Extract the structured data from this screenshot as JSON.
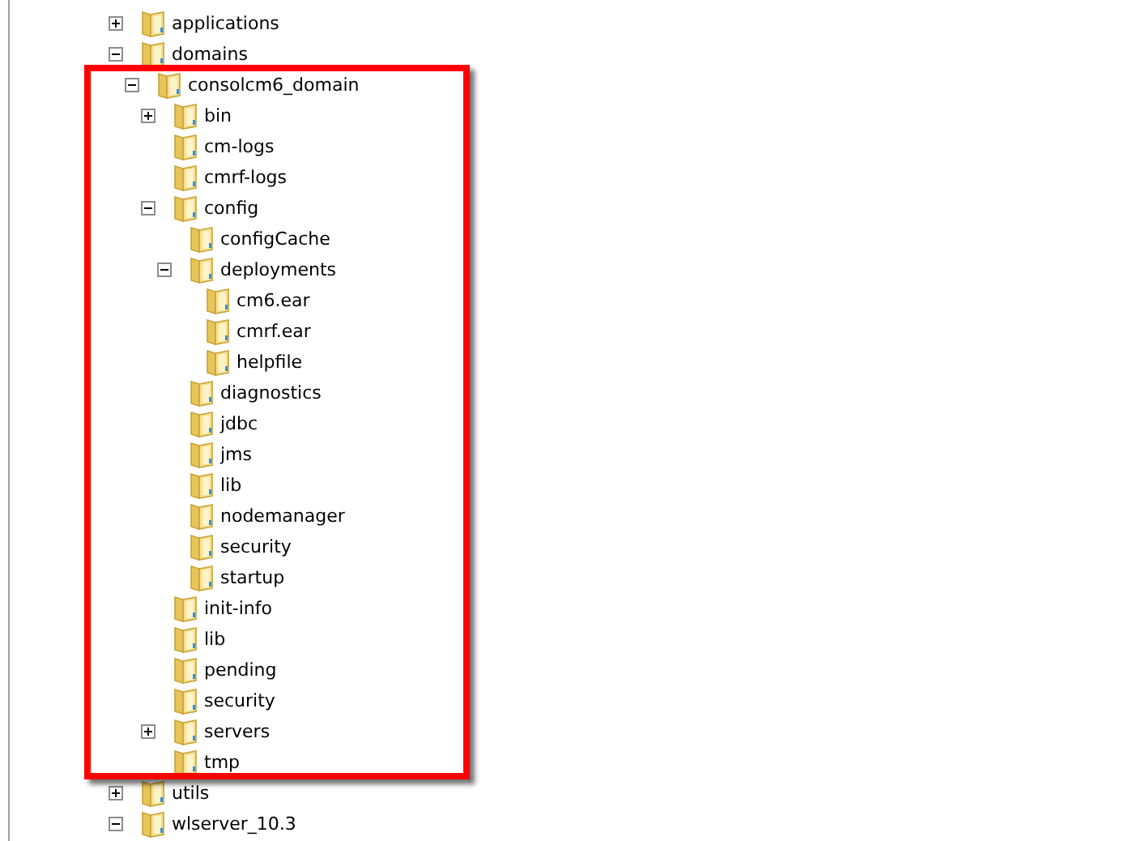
{
  "tree": [
    {
      "label": "applications",
      "kind": "branch",
      "expanded": false
    },
    {
      "label": "domains",
      "kind": "branch",
      "expanded": true,
      "children": [
        {
          "label": "consolcm6_domain",
          "kind": "branch",
          "expanded": true,
          "children": [
            {
              "label": "bin",
              "kind": "branch",
              "expanded": false
            },
            {
              "label": "cm-logs",
              "kind": "leaf"
            },
            {
              "label": "cmrf-logs",
              "kind": "leaf"
            },
            {
              "label": "config",
              "kind": "branch",
              "expanded": true,
              "children": [
                {
                  "label": "configCache",
                  "kind": "leaf"
                },
                {
                  "label": "deployments",
                  "kind": "branch",
                  "expanded": true,
                  "children": [
                    {
                      "label": "cm6.ear",
                      "kind": "leaf"
                    },
                    {
                      "label": "cmrf.ear",
                      "kind": "leaf"
                    },
                    {
                      "label": "helpfile",
                      "kind": "leaf"
                    }
                  ]
                },
                {
                  "label": "diagnostics",
                  "kind": "leaf"
                },
                {
                  "label": "jdbc",
                  "kind": "leaf"
                },
                {
                  "label": "jms",
                  "kind": "leaf"
                },
                {
                  "label": "lib",
                  "kind": "leaf"
                },
                {
                  "label": "nodemanager",
                  "kind": "leaf"
                },
                {
                  "label": "security",
                  "kind": "leaf"
                },
                {
                  "label": "startup",
                  "kind": "leaf"
                }
              ]
            },
            {
              "label": "init-info",
              "kind": "leaf"
            },
            {
              "label": "lib",
              "kind": "leaf"
            },
            {
              "label": "pending",
              "kind": "leaf"
            },
            {
              "label": "security",
              "kind": "leaf"
            },
            {
              "label": "servers",
              "kind": "branch",
              "expanded": false
            },
            {
              "label": "tmp",
              "kind": "leaf"
            }
          ]
        }
      ]
    },
    {
      "label": "utils",
      "kind": "branch",
      "expanded": false
    },
    {
      "label": "wlserver_10.3",
      "kind": "branch",
      "expanded": true
    }
  ]
}
